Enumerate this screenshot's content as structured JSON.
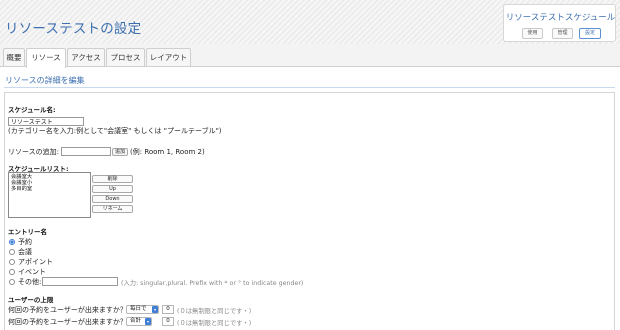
{
  "header": {
    "title": "リソーステストの設定"
  },
  "schedule_box": {
    "title": "リソーステストスケジュール",
    "buttons": [
      "使用",
      "管理",
      "設定"
    ]
  },
  "tabs": [
    {
      "label": "概要"
    },
    {
      "label": "リソース",
      "active": true
    },
    {
      "label": "アクセス"
    },
    {
      "label": "プロセス"
    },
    {
      "label": "レイアウト"
    }
  ],
  "section": {
    "title": "リソースの詳細を編集"
  },
  "form": {
    "schedule_name_label": "スケジュール名:",
    "schedule_name_value": "リソーステスト",
    "schedule_name_hint": "(カテゴリー名を入力:例として\"会議室\" もしくは \"プールテーブル\")",
    "add_resource_label": "リソースの追加:",
    "add_button": "追加",
    "add_example": "(例: Room 1, Room 2)",
    "schedule_list_label": "スケジュールリスト:",
    "schedule_list_items": [
      "会議室大",
      "会議室小",
      "多目的室"
    ],
    "list_buttons": [
      "削除",
      "Up",
      "Down",
      "リネーム"
    ],
    "entry_name_label": "エントリー名",
    "entry_options": [
      {
        "label": "予約",
        "checked": true
      },
      {
        "label": "会議",
        "checked": false
      },
      {
        "label": "アポイント",
        "checked": false
      },
      {
        "label": "イベント",
        "checked": false
      },
      {
        "label": "その他:",
        "checked": false
      }
    ],
    "other_hint": "(入力: singular,plural. Prefix with * or ° to indicate gender)",
    "user_limit_label": "ユーザーの上限",
    "limit_rows": [
      {
        "question": "何回の予約をユーザーが出来ますか？",
        "period": "毎日で",
        "count": "0",
        "note": "(０は無制限と同じです・)"
      },
      {
        "question": "何回の予約をユーザーが出来ますか？",
        "period": "合計",
        "count": "0",
        "note": "(０は無制限と同じです・)"
      }
    ]
  },
  "colors": {
    "accent": "#3d6fb0",
    "radio_checked": "#3f7fd6"
  }
}
